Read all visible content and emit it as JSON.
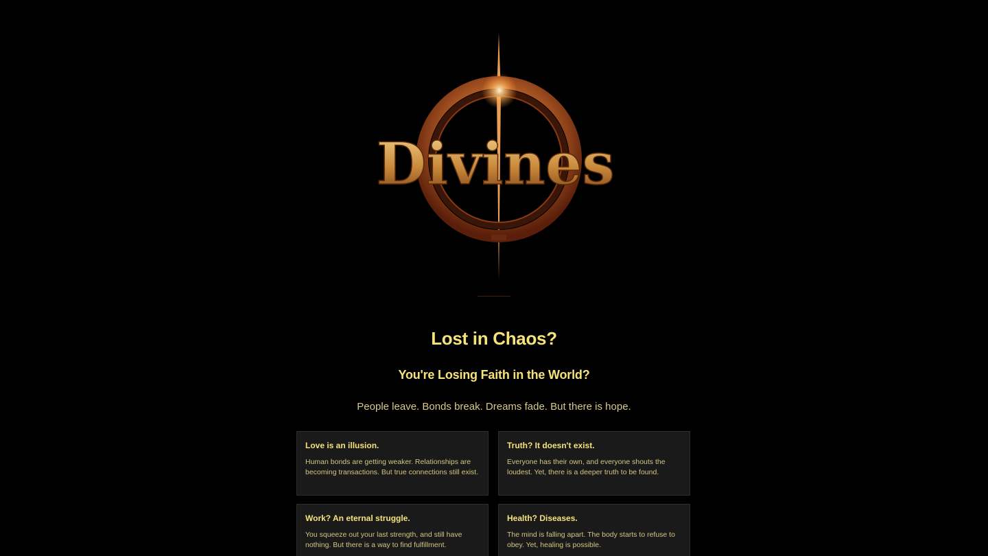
{
  "logo": {
    "text": "Divines"
  },
  "hero": {
    "headline": "Lost in Chaos?",
    "subheadline": "You're Losing Faith in the World?",
    "tagline": "People leave. Bonds break. Dreams fade. But there is hope."
  },
  "cards": [
    {
      "title": "Love is an illusion.",
      "body": "Human bonds are getting weaker. Relationships are becoming transactions. But true connections still exist."
    },
    {
      "title": "Truth? It doesn't exist.",
      "body": "Everyone has their own, and everyone shouts the loudest. Yet, there is a deeper truth to be found."
    },
    {
      "title": "Work? An eternal struggle.",
      "body": "You squeeze out your last strength, and still have nothing. But there is a way to find fulfillment."
    },
    {
      "title": "Health? Diseases.",
      "body": "The mind is falling apart. The body starts to refuse to obey. Yet, healing is possible."
    }
  ],
  "colors": {
    "background": "#000000",
    "accent_gold": "#f6e27a",
    "card_background": "#1a1a1a",
    "logo_ring": "#c0602a"
  }
}
